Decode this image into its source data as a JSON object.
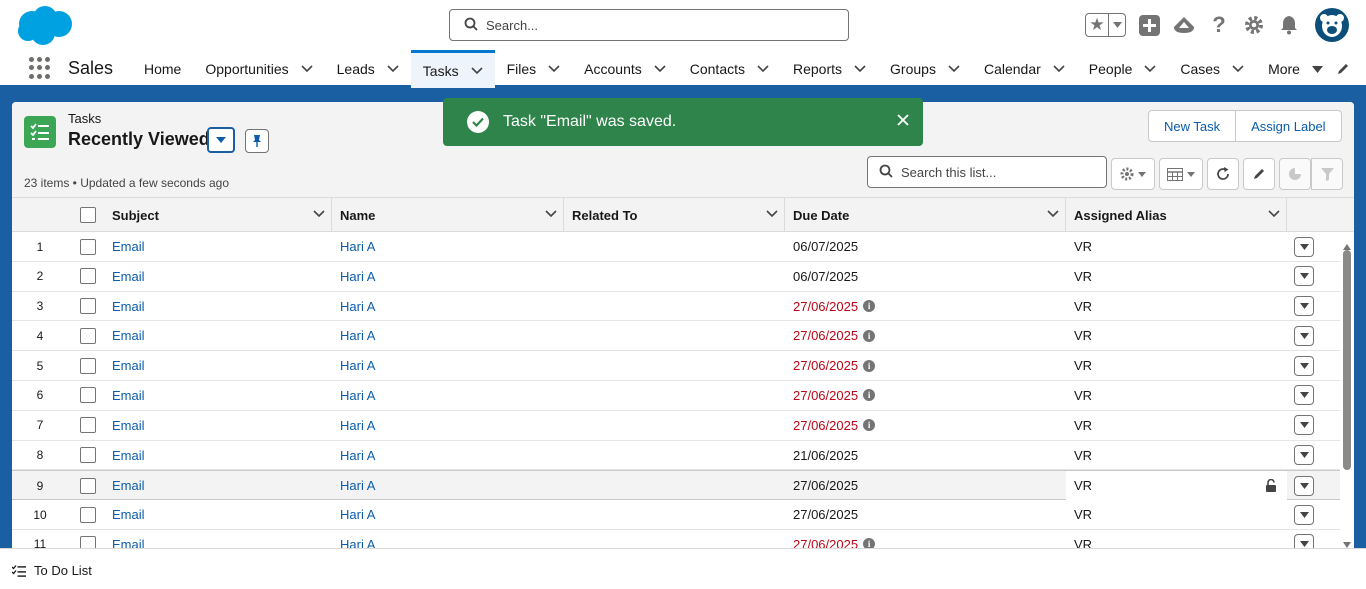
{
  "header": {
    "search_placeholder": "Search...",
    "icons": [
      "favorites-star-icon",
      "add-icon",
      "trailhead-icon",
      "help-icon",
      "setup-gear-icon",
      "notifications-bell-icon",
      "avatar"
    ]
  },
  "nav": {
    "app_name": "Sales",
    "items": [
      {
        "label": "Home",
        "has_menu": false
      },
      {
        "label": "Opportunities",
        "has_menu": true
      },
      {
        "label": "Leads",
        "has_menu": true
      },
      {
        "label": "Tasks",
        "has_menu": true,
        "active": true
      },
      {
        "label": "Files",
        "has_menu": true
      },
      {
        "label": "Accounts",
        "has_menu": true
      },
      {
        "label": "Contacts",
        "has_menu": true
      },
      {
        "label": "Reports",
        "has_menu": true
      },
      {
        "label": "Groups",
        "has_menu": true
      },
      {
        "label": "Calendar",
        "has_menu": true
      },
      {
        "label": "People",
        "has_menu": true
      },
      {
        "label": "Cases",
        "has_menu": true
      },
      {
        "label": "More",
        "has_menu": true
      }
    ]
  },
  "list_view": {
    "object_label": "Tasks",
    "title": "Recently Viewed",
    "meta": "23 items • Updated a few seconds ago",
    "new_button": "New Task",
    "assign_button": "Assign Label",
    "search_placeholder": "Search this list..."
  },
  "toast": {
    "message": "Task \"Email\" was saved.",
    "color": "#2e844a"
  },
  "table": {
    "columns": [
      "Subject",
      "Name",
      "Related To",
      "Due Date",
      "Assigned Alias"
    ],
    "rows": [
      {
        "num": "1",
        "subject": "Email",
        "name": "Hari A",
        "related": "",
        "due": "06/07/2025",
        "overdue": false,
        "alias": "VR"
      },
      {
        "num": "2",
        "subject": "Email",
        "name": "Hari A",
        "related": "",
        "due": "06/07/2025",
        "overdue": false,
        "alias": "VR"
      },
      {
        "num": "3",
        "subject": "Email",
        "name": "Hari A",
        "related": "",
        "due": "27/06/2025",
        "overdue": true,
        "alias": "VR"
      },
      {
        "num": "4",
        "subject": "Email",
        "name": "Hari A",
        "related": "",
        "due": "27/06/2025",
        "overdue": true,
        "alias": "VR"
      },
      {
        "num": "5",
        "subject": "Email",
        "name": "Hari A",
        "related": "",
        "due": "27/06/2025",
        "overdue": true,
        "alias": "VR"
      },
      {
        "num": "6",
        "subject": "Email",
        "name": "Hari A",
        "related": "",
        "due": "27/06/2025",
        "overdue": true,
        "alias": "VR"
      },
      {
        "num": "7",
        "subject": "Email",
        "name": "Hari A",
        "related": "",
        "due": "27/06/2025",
        "overdue": true,
        "alias": "VR"
      },
      {
        "num": "8",
        "subject": "Email",
        "name": "Hari A",
        "related": "",
        "due": "21/06/2025",
        "overdue": false,
        "alias": "VR"
      },
      {
        "num": "9",
        "subject": "Email",
        "name": "Hari A",
        "related": "",
        "due": "27/06/2025",
        "overdue": false,
        "alias": "VR",
        "highlighted": true
      },
      {
        "num": "10",
        "subject": "Email",
        "name": "Hari A",
        "related": "",
        "due": "27/06/2025",
        "overdue": false,
        "alias": "VR"
      },
      {
        "num": "11",
        "subject": "Email",
        "name": "Hari A",
        "related": "",
        "due": "27/06/2025",
        "overdue": true,
        "alias": "VR"
      }
    ]
  },
  "utility_bar": {
    "item_label": "To Do List"
  },
  "colors": {
    "brand_blue": "#1b5fa3",
    "link": "#0b5cab",
    "overdue": "#ba0517",
    "task_icon": "#3ba755"
  }
}
